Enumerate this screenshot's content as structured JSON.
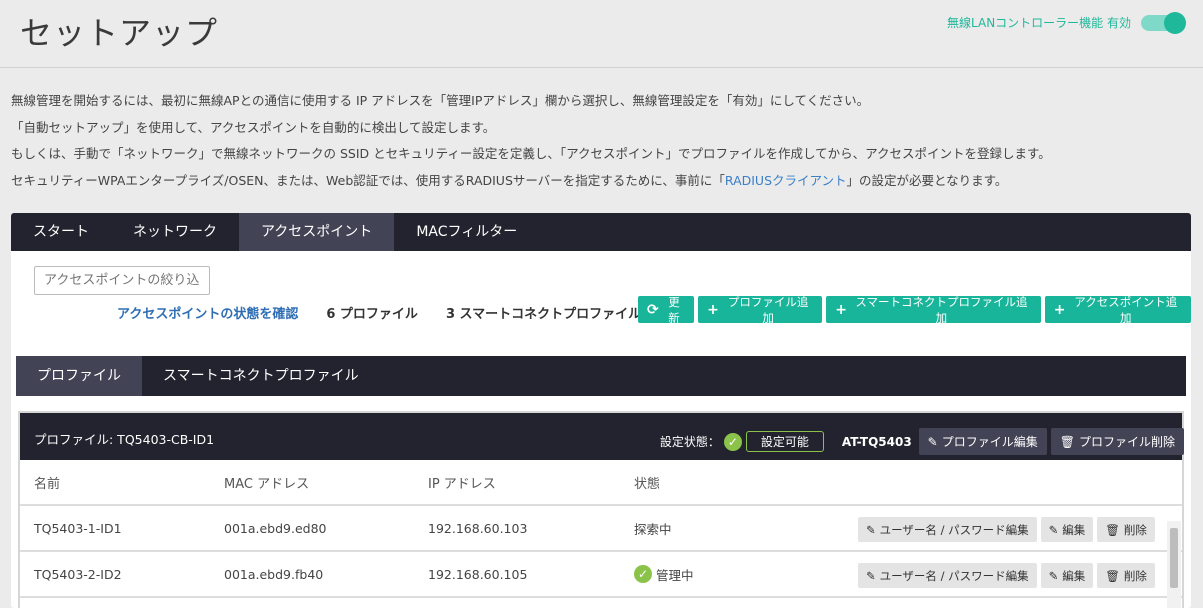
{
  "header": {
    "title": "セットアップ",
    "toggle_label": "無線LANコントローラー機能 有効",
    "toggle_on": true,
    "accent_color": "#1fb89a"
  },
  "description": {
    "line1": "無線管理を開始するには、最初に無線APとの通信に使用する IP アドレスを「管理IPアドレス」欄から選択し、無線管理設定を「有効」にしてください。",
    "line2": "「自動セットアップ」を使用して、アクセスポイントを自動的に検出して設定します。",
    "line3": "もしくは、手動で「ネットワーク」で無線ネットワークの SSID とセキュリティー設定を定義し、「アクセスポイント」でプロファイルを作成してから、アクセスポイントを登録します。",
    "line4_pre": "セキュリティーWPAエンタープライズ/OSEN、または、Web認証では、使用するRADIUSサーバーを指定するために、事前に「",
    "line4_link": "RADIUSクライアント",
    "line4_post": "」の設定が必要となります。"
  },
  "tabs": [
    {
      "label": "スタート"
    },
    {
      "label": "ネットワーク"
    },
    {
      "label": "アクセスポイント",
      "active": true
    },
    {
      "label": "MACフィルター"
    }
  ],
  "filter": {
    "placeholder": "アクセスポイントの絞り込み"
  },
  "stats": {
    "status_link": "アクセスポイントの状態を確認",
    "profiles": "6 プロファイル",
    "smart_profiles": "3 スマートコネクトプロファイル"
  },
  "actions": {
    "refresh": "更新",
    "add_profile": "プロファイル追加",
    "add_smart_profile": "スマートコネクトプロファイル追加",
    "add_ap": "アクセスポイント追加"
  },
  "subtabs": [
    {
      "label": "プロファイル",
      "active": true
    },
    {
      "label": "スマートコネクトプロファイル"
    }
  ],
  "profile_card": {
    "title": "プロファイル: TQ5403-CB-ID1",
    "status_label": "設定状態：",
    "status_value": "設定可能",
    "model": "AT-TQ5403",
    "edit_label": "プロファイル編集",
    "delete_label": "プロファイル削除",
    "columns": {
      "name": "名前",
      "mac": "MAC アドレス",
      "ip": "IP アドレス",
      "state": "状態"
    },
    "rows": [
      {
        "name": "TQ5403-1-ID1",
        "mac": "001a.ebd9.ed80",
        "ip": "192.168.60.103",
        "state": "探索中",
        "managed": false
      },
      {
        "name": "TQ5403-2-ID2",
        "mac": "001a.ebd9.fb40",
        "ip": "192.168.60.105",
        "state": "管理中",
        "managed": true
      }
    ],
    "row_actions": {
      "user_pw": "ユーザー名 / パスワード編集",
      "edit": "編集",
      "delete": "削除"
    }
  }
}
